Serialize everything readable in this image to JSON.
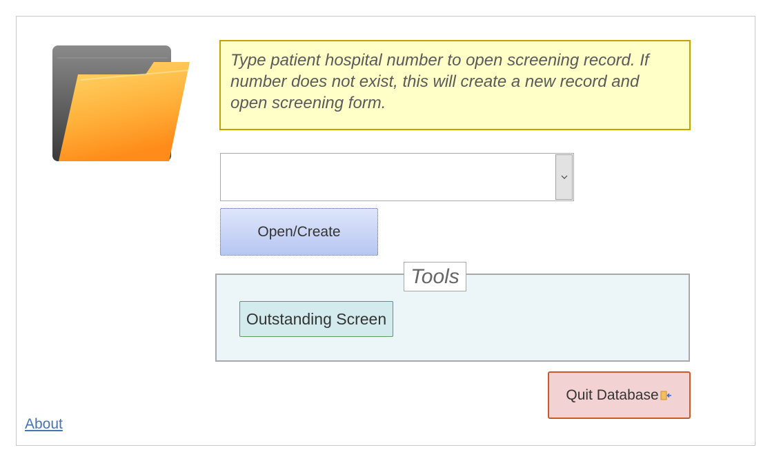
{
  "instruction": {
    "text": "Type patient hospital number to open screening record. If number does not exist, this will create a new record and open screening form."
  },
  "patient_number_combo": {
    "value": ""
  },
  "open_create_button": {
    "label": "Open/Create"
  },
  "tools": {
    "label": "Tools",
    "outstanding_screen_button": {
      "label": "Outstanding Screen"
    }
  },
  "quit_button": {
    "label": "Quit Database",
    "icon": "exit-door-icon"
  },
  "about_link": {
    "label": "About"
  },
  "colors": {
    "instruction_bg": "#ffffc8",
    "open_button": "#c2cff5",
    "tools_bg": "#ecf5f8",
    "outstanding_button": "#d3ebed",
    "quit_button": "#f2d2d2",
    "link": "#4a72b0"
  }
}
